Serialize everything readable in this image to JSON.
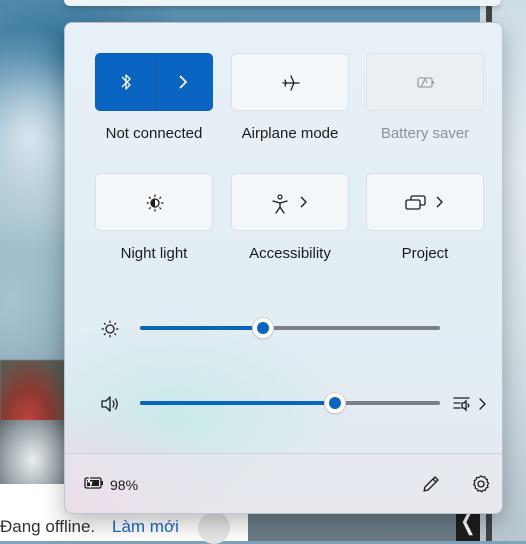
{
  "quick_settings": {
    "tiles": [
      {
        "label": "Not connected",
        "icon": "bluetooth-icon",
        "state": "on",
        "has_arrow": true
      },
      {
        "label": "Airplane mode",
        "icon": "airplane-icon",
        "state": "off"
      },
      {
        "label": "Battery saver",
        "icon": "battery-saver-icon",
        "state": "disabled"
      },
      {
        "label": "Night light",
        "icon": "night-light-icon",
        "state": "off"
      },
      {
        "label": "Accessibility",
        "icon": "accessibility-icon",
        "state": "off",
        "has_arrow": true
      },
      {
        "label": "Project",
        "icon": "project-icon",
        "state": "off",
        "has_arrow": true
      }
    ],
    "brightness": {
      "icon": "brightness-icon",
      "level_percent": 41
    },
    "volume": {
      "icon": "speaker-icon",
      "level_percent": 65
    },
    "footer": {
      "battery_percent": "98%",
      "battery_icon": "battery-charging-icon",
      "edit_icon": "pencil-icon",
      "settings_icon": "gear-icon"
    },
    "accent_color": "#0a64c2"
  },
  "background": {
    "status_text": "Đang offline.",
    "refresh_link": "Làm mới"
  }
}
